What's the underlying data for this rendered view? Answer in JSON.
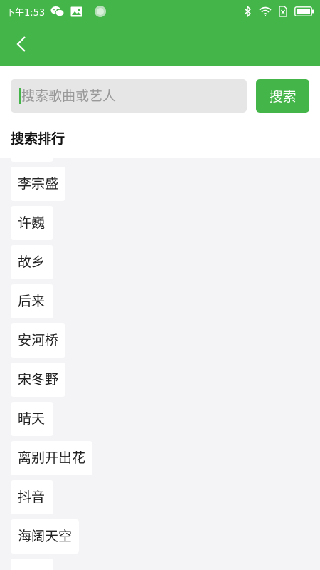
{
  "status_bar": {
    "time": "下午1:53",
    "left_icons": [
      "wechat-icon",
      "image-icon",
      "circle-icon"
    ],
    "right_icons": [
      "bluetooth-icon",
      "wifi-icon",
      "sim-off-icon",
      "battery-icon"
    ]
  },
  "header": {
    "back_icon": "chevron-left-icon"
  },
  "search": {
    "placeholder": "搜索歌曲或艺人",
    "value": "",
    "button_label": "搜索"
  },
  "ranking": {
    "title": "搜索排行",
    "items": [
      "",
      "李宗盛",
      "许巍",
      "故乡",
      "后来",
      "安河桥",
      "宋冬野",
      "晴天",
      "离别开出花",
      "抖音",
      "海阔天空",
      ""
    ]
  },
  "colors": {
    "primary_green": "#44b549",
    "search_field_bg": "#e6e6e6",
    "list_bg": "#f4f4f7"
  }
}
